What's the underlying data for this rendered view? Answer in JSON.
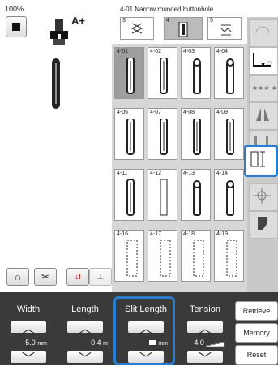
{
  "zoom_label": "100%",
  "header": {
    "title": "4-01  Narrow rounded buttonhole",
    "categories": [
      {
        "num": "3",
        "selected": false
      },
      {
        "num": "4",
        "selected": true
      },
      {
        "num": "5",
        "selected": false
      }
    ]
  },
  "foot_code": "A+",
  "stitches": [
    [
      "4-01",
      "4-02",
      "4-03",
      "4-04"
    ],
    [
      "4-06",
      "4-07",
      "4-08",
      "4-09"
    ],
    [
      "4-11",
      "4-12",
      "4-13",
      "4-14"
    ],
    [
      "4-16",
      "4-17",
      "4-18",
      "4-19"
    ]
  ],
  "selected_stitch": "4-01",
  "controls": {
    "width": {
      "label": "Width",
      "value": "5.0",
      "unit": "mm"
    },
    "length": {
      "label": "Length",
      "value": "0.4",
      "unit": "m"
    },
    "slit": {
      "label": "Slit Length",
      "value": "",
      "unit": "mm"
    },
    "tension": {
      "label": "Tension",
      "value": "4.0"
    }
  },
  "actions": {
    "retrieve": "Retrieve",
    "memory": "Memory",
    "reset": "Reset"
  },
  "colors": {
    "accent": "#2a7ccf",
    "panel": "#3a3a3a"
  }
}
